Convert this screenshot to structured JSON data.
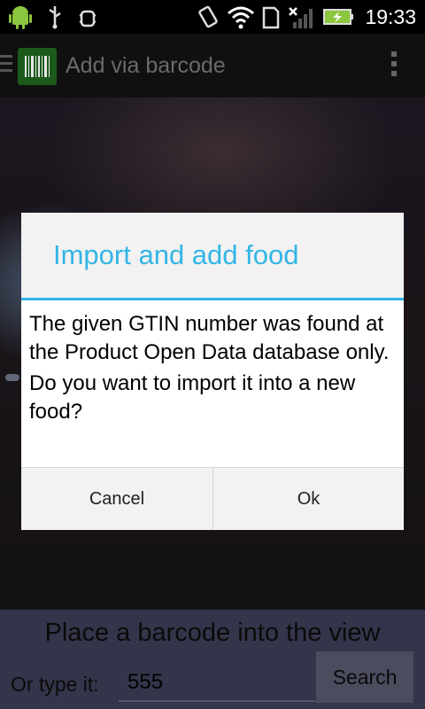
{
  "status_bar": {
    "time": "19:33",
    "left_icons": [
      "android-icon",
      "usb-icon",
      "debug-icon"
    ],
    "right_icons": [
      "vibrate-icon",
      "wifi-icon",
      "sd-card-icon",
      "signal-icon",
      "battery-charging-icon"
    ]
  },
  "action_bar": {
    "title": "Add via barcode",
    "icons": [
      "drawer-menu-icon",
      "barcode-icon",
      "overflow-menu-icon"
    ]
  },
  "dialog": {
    "title": "Import and add food",
    "message_lines": [
      "The given GTIN number was found at the Product Open Data database only.",
      "Do you want to import it into a new food?"
    ],
    "cancel_label": "Cancel",
    "ok_label": "Ok"
  },
  "bottom_panel": {
    "hint": "Place a barcode into the view",
    "type_label": "Or type it:",
    "input_value": "555",
    "search_label": "Search"
  },
  "colors": {
    "accent": "#33b5e5",
    "bottom_panel": "#34354a",
    "action_bar": "#101010"
  }
}
